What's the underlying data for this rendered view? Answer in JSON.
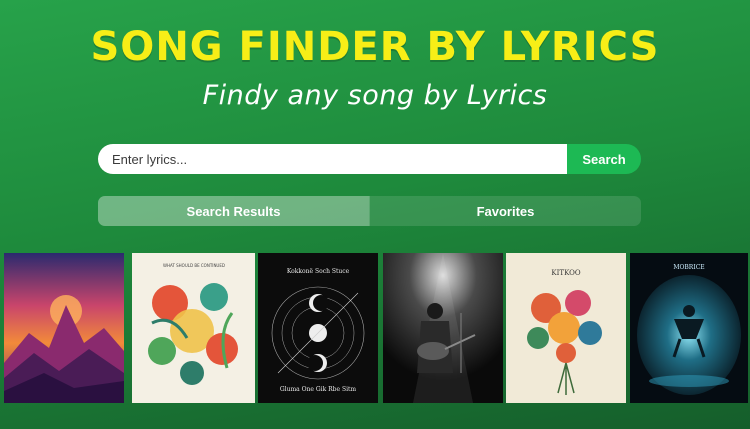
{
  "header": {
    "title": "SONG FINDER BY LYRICS",
    "subtitle": "Findy any song by Lyrics"
  },
  "search": {
    "placeholder": "Enter lyrics...",
    "button_label": "Search"
  },
  "tabs": [
    {
      "label": "Search Results",
      "active": true
    },
    {
      "label": "Favorites",
      "active": false
    }
  ],
  "results": [
    {
      "name": "album-cover-sunset-mountain",
      "poster_text": []
    },
    {
      "name": "album-cover-floral-illustration",
      "poster_text": [
        "WHAT SHOULD BE CONTINUED"
      ]
    },
    {
      "name": "album-cover-moon-phases",
      "poster_text": [
        "Kokkonë Soch Stuce",
        "Gluma One Gik Rbe Sitm"
      ]
    },
    {
      "name": "album-cover-concert-guitarist",
      "poster_text": []
    },
    {
      "name": "album-cover-flower-bouquet",
      "poster_text": [
        "KITKOO"
      ]
    },
    {
      "name": "album-cover-stage-light",
      "poster_text": [
        "MOBRICE"
      ]
    }
  ],
  "colors": {
    "title": "#f7ee17",
    "accent": "#1db954",
    "background_top": "#27a24a",
    "background_bottom": "#155e2b"
  }
}
